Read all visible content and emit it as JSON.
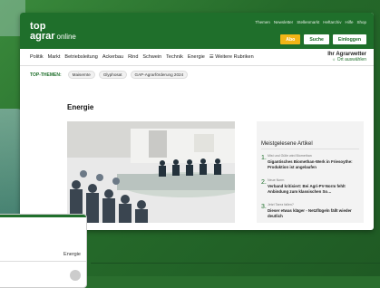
{
  "header": {
    "logo_line1": "top",
    "logo_line2": "agrar",
    "logo_line3": "online",
    "top_links": [
      "Themen",
      "Newsletter",
      "Stellenmarkt",
      "Heftarchiv",
      "Hilfe",
      "Shop"
    ],
    "buttons": {
      "abo": "Abo",
      "suche": "Suche",
      "einloggen": "Einloggen"
    }
  },
  "nav": {
    "items": [
      "Politik",
      "Markt",
      "Betriebsleitung",
      "Ackerbau",
      "Rind",
      "Schwein",
      "Technik",
      "Energie",
      "☰ Weitere Rubriken"
    ],
    "weather_title": "Ihr Agrarwetter",
    "weather_link": "Ort auswählen"
  },
  "topics": {
    "label": "TOP-THEMEN:",
    "chips": [
      "Maisernte",
      "Glyphosat",
      "GAP-Agrarförderung 2024"
    ]
  },
  "page": {
    "title": "Energie"
  },
  "sidebar": {
    "title": "Meistgelesene Artikel",
    "articles": [
      {
        "n": "1.",
        "kicker": "Mist und Gülle wird Biomethan",
        "headline": "Gigantisches Biomethan-Werk in Friesoythe: Produktion ist angelaufen"
      },
      {
        "n": "2.",
        "kicker": "Neue Norm",
        "headline": "Verband kritisiert: Bei Agri-PV-Norm fehlt Anbindung zum klassischen So…"
      },
      {
        "n": "3.",
        "kicker": "Jetzt Tarez fallen?",
        "headline": "Dieser etwas kläger - Netzflügeln fällt wieder deutlich"
      }
    ]
  },
  "second_window": {
    "label": "Energie"
  },
  "colors": {
    "brand": "#1f6f2b",
    "accent": "#f2b517"
  }
}
